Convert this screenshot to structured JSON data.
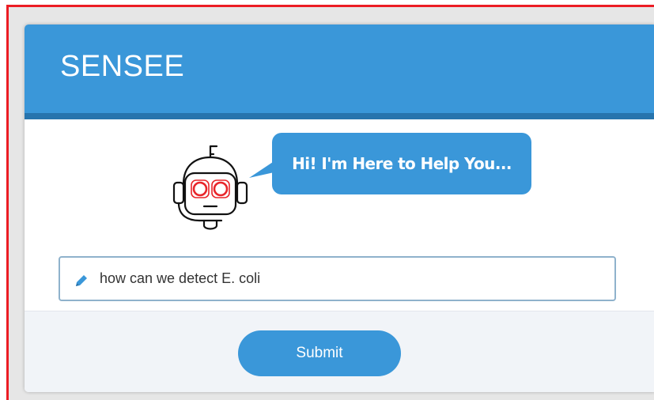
{
  "app": {
    "title": "SENSEE"
  },
  "bot": {
    "avatar_icon": "robot-headset-icon",
    "greeting": "Hi! I'm Here to Help You..."
  },
  "query": {
    "icon": "pencil-icon",
    "value": "how can we detect E. coli"
  },
  "actions": {
    "submit_label": "Submit"
  },
  "colors": {
    "primary": "#3a97d9",
    "header_border": "#2774ad",
    "frame_border": "#ec1c24",
    "bot_eyes": "#e8262b"
  }
}
